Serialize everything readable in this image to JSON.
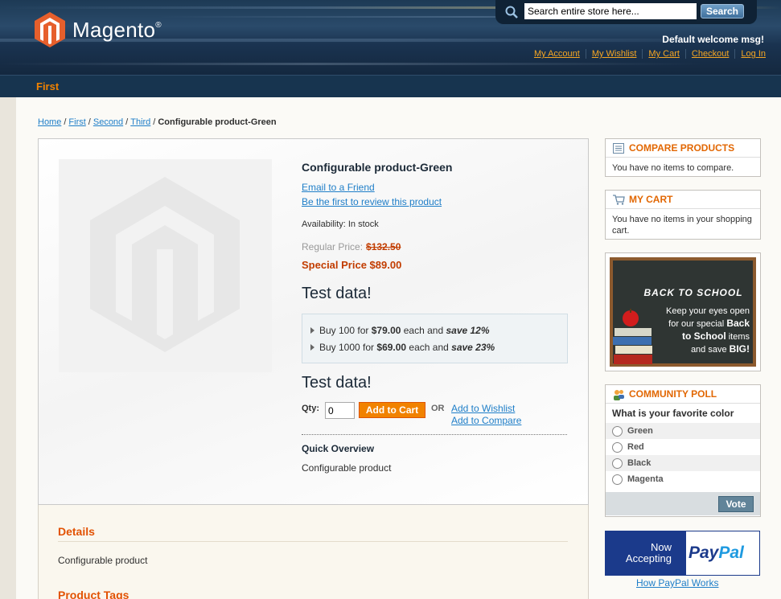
{
  "header": {
    "logo_text": "Magento",
    "logo_mark": "®",
    "search_placeholder": "Search entire store here...",
    "search_button": "Search",
    "welcome": "Default welcome msg!",
    "links": [
      "My Account",
      "My Wishlist",
      "My Cart",
      "Checkout",
      "Log In"
    ]
  },
  "nav": {
    "item": "First"
  },
  "breadcrumbs": {
    "items": [
      "Home",
      "First",
      "Second",
      "Third"
    ],
    "current": "Configurable product-Green"
  },
  "product": {
    "name": "Configurable product-Green",
    "email_friend": "Email to a Friend",
    "review_link": "Be the first to review this product",
    "availability": "Availability: In stock",
    "regular_price_label": "Regular Price:",
    "regular_price": "$132.50",
    "special_price": "Special Price $89.00",
    "test_text_1": "Test data!",
    "tiers": [
      {
        "prefix": "Buy 100 for ",
        "price": "$79.00",
        "mid": " each and ",
        "save": "save 12%"
      },
      {
        "prefix": "Buy 1000 for ",
        "price": "$69.00",
        "mid": " each and ",
        "save": "save 23%"
      }
    ],
    "test_text_2": "Test data!",
    "qty_label": "Qty:",
    "qty_value": "0",
    "add_to_cart": "Add to Cart",
    "or": "OR",
    "add_wishlist": "Add to Wishlist",
    "add_compare": "Add to Compare",
    "quick_overview_title": "Quick Overview",
    "quick_overview_text": "Configurable product"
  },
  "details": {
    "title": "Details",
    "text": "Configurable product",
    "tags_title": "Product Tags"
  },
  "sidebar": {
    "compare": {
      "title": "COMPARE PRODUCTS",
      "text": "You have no items to compare."
    },
    "cart": {
      "title": "MY CART",
      "text": "You have no items in your shopping cart."
    },
    "banner": {
      "title": "BACK TO SCHOOL",
      "line1": "Keep your eyes open",
      "line2": "for our special",
      "bold1": "Back",
      "bold2": "to School",
      "line3": "items",
      "line4": "and save",
      "bold3": "BIG!"
    },
    "poll": {
      "title": "COMMUNITY POLL",
      "question": "What is your favorite color",
      "options": [
        "Green",
        "Red",
        "Black",
        "Magenta"
      ],
      "vote": "Vote"
    },
    "paypal": {
      "now": "Now",
      "accepting": "Accepting",
      "pay": "Pay",
      "pal": "Pal",
      "link": "How PayPal Works"
    }
  },
  "colors": {
    "accent_orange": "#f18200",
    "link_blue": "#1e7ec8",
    "header_navy": "#1d3a55",
    "price_red": "#c23d00"
  }
}
